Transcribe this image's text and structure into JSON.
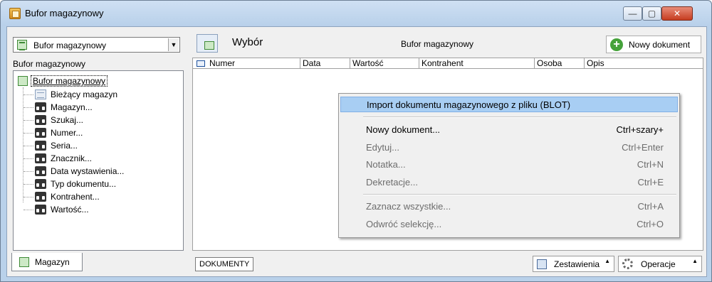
{
  "window": {
    "title": "Bufor magazynowy",
    "buttons": {
      "minimize": "—",
      "maximize": "▢",
      "close": "✕"
    }
  },
  "left": {
    "combo_value": "Bufor magazynowy",
    "heading": "Bufor magazynowy",
    "tree": {
      "root": "Bufor magazynowy",
      "items": [
        {
          "label": "Bieżący magazyn",
          "icon": "table-icon"
        },
        {
          "label": "Magazyn...",
          "icon": "binoculars-icon"
        },
        {
          "label": "Szukaj...",
          "icon": "binoculars-icon"
        },
        {
          "label": "Numer...",
          "icon": "binoculars-icon"
        },
        {
          "label": "Seria...",
          "icon": "binoculars-icon"
        },
        {
          "label": "Znacznik...",
          "icon": "binoculars-icon"
        },
        {
          "label": "Data wystawienia...",
          "icon": "binoculars-icon"
        },
        {
          "label": "Typ dokumentu...",
          "icon": "binoculars-icon"
        },
        {
          "label": "Kontrahent...",
          "icon": "binoculars-icon"
        },
        {
          "label": "Wartość...",
          "icon": "binoculars-icon"
        }
      ]
    },
    "tab": "Magazyn"
  },
  "right": {
    "title": "Wybór",
    "center_label": "Bufor magazynowy",
    "new_button": "Nowy dokument",
    "columns": [
      "Numer",
      "Data",
      "Wartość",
      "Kontrahent",
      "Osoba",
      "Opis"
    ],
    "bottom": {
      "dokumenty": "DOKUMENTY",
      "zestawienia": "Zestawienia",
      "operacje": "Operacje"
    }
  },
  "context_menu": {
    "items": [
      {
        "label": "Import dokumentu magazynowego z pliku (BLOT)",
        "shortcut": "",
        "state": "highlighted"
      },
      {
        "label": "Nowy dokument...",
        "shortcut": "Ctrl+szary+",
        "state": "enabled"
      },
      {
        "label": "Edytuj...",
        "shortcut": "Ctrl+Enter",
        "state": "disabled"
      },
      {
        "label": "Notatka...",
        "shortcut": "Ctrl+N",
        "state": "disabled"
      },
      {
        "label": "Dekretacje...",
        "shortcut": "Ctrl+E",
        "state": "disabled"
      },
      {
        "label": "Zaznacz wszystkie...",
        "shortcut": "Ctrl+A",
        "state": "disabled"
      },
      {
        "label": "Odwróć selekcję...",
        "shortcut": "Ctrl+O",
        "state": "disabled"
      }
    ]
  },
  "colors": {
    "menu_highlight": "#a8cef3",
    "window_frame": "#b9d1ea"
  }
}
